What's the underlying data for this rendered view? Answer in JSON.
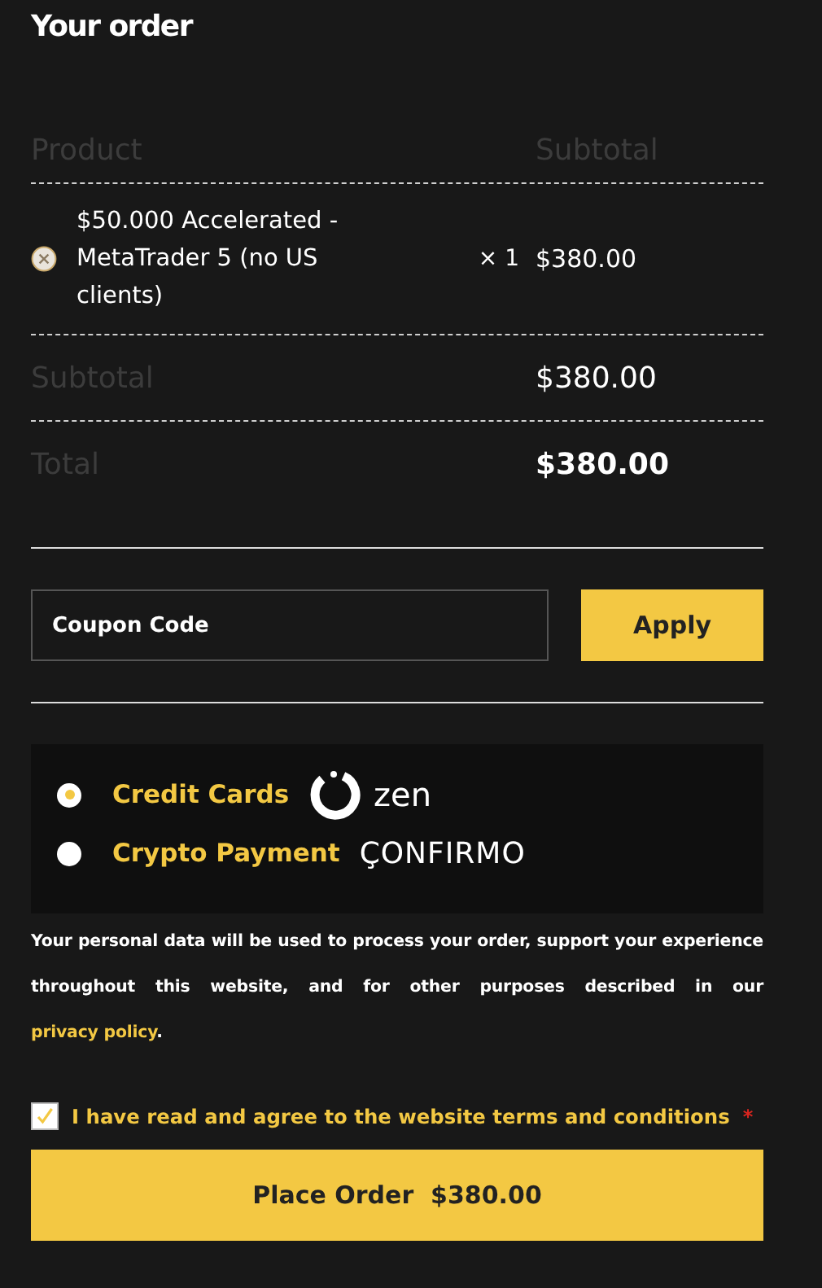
{
  "title": "Your order",
  "table": {
    "columns": [
      "Product",
      "Subtotal"
    ],
    "items": [
      {
        "name": "$50.000 Accelerated - MetaTrader 5 (no US clients)",
        "quantity": "× 1",
        "subtotal": "$380.00"
      }
    ],
    "subtotal": {
      "label": "Subtotal",
      "value": "$380.00"
    },
    "total": {
      "label": "Total",
      "value": "$380.00"
    }
  },
  "coupon": {
    "placeholder": "Coupon Code",
    "button": "Apply"
  },
  "payment_methods": [
    {
      "label": "Credit Cards",
      "logo_text": "zen",
      "kind": "ring",
      "selected": true
    },
    {
      "label": "Crypto Payment",
      "logo_text": "ÇONFIRMO",
      "kind": "plain",
      "selected": false
    }
  ],
  "privacy": {
    "text": "Your personal data will be used to process your order, support your experience throughout this website, and for other purposes described in our",
    "link": "privacy policy",
    "suffix": "."
  },
  "terms": {
    "label": "I have read and agree to the website terms and conditions",
    "required_mark": "*",
    "checked": true
  },
  "place_order": {
    "label": "Place Order",
    "amount": "$380.00"
  }
}
